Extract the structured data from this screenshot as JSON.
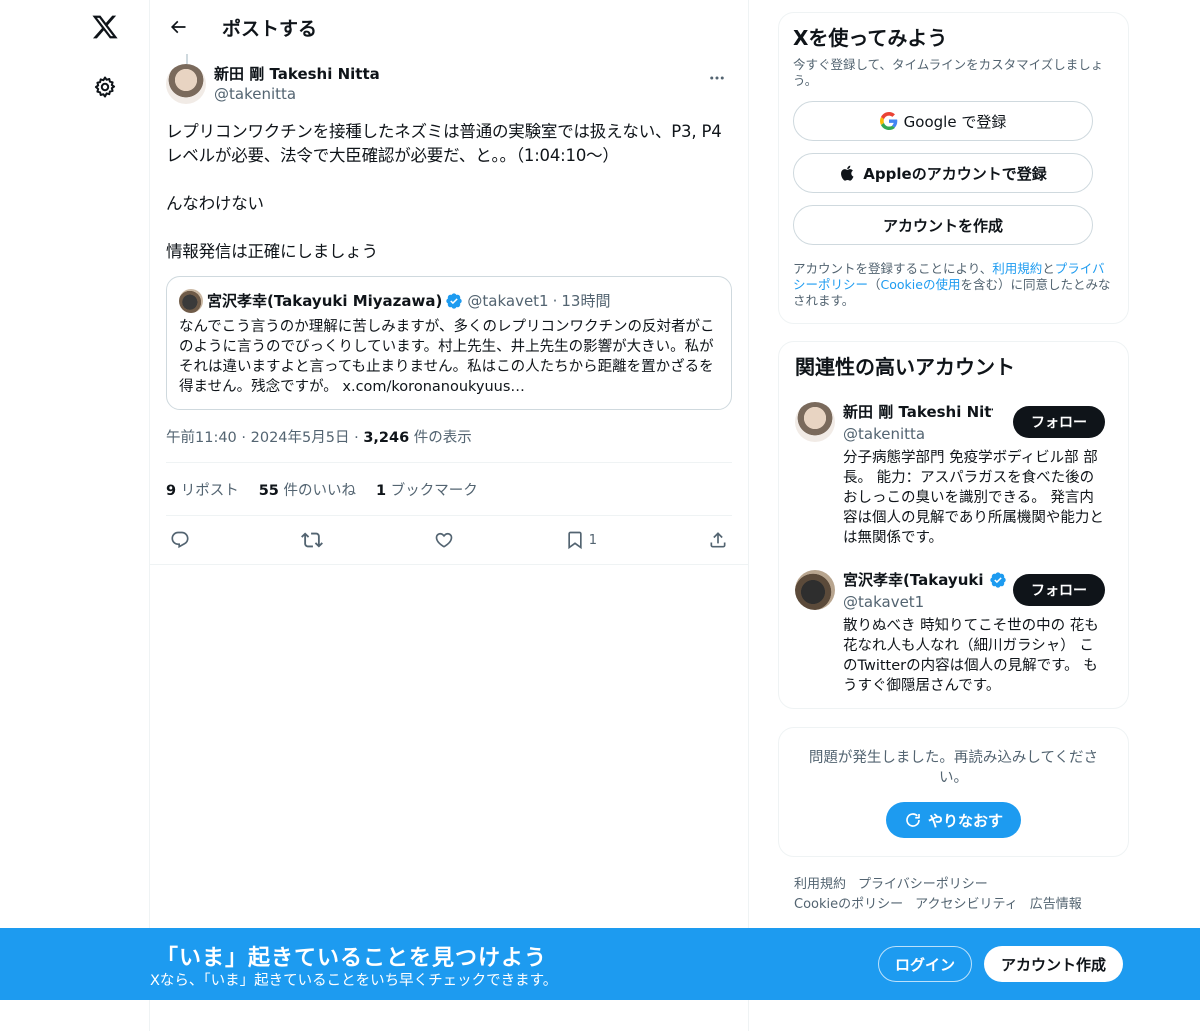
{
  "colors": {
    "accent": "#1d9bf0",
    "text": "#0f1419",
    "secondary": "#536471",
    "border": "#eff3f4"
  },
  "header": {
    "title": "ポストする"
  },
  "tweet": {
    "display_name": "新田 剛 Takeshi Nitta",
    "handle": "@takenitta",
    "body": "レプリコンワクチンを接種したネズミは普通の実験室では扱えない、P3, P4レベルが必要、法令で大臣確認が必要だ、と。。（1:04:10〜）\n\nんなわけない\n\n情報発信は正確にしましょう",
    "quote": {
      "display_name": "宮沢孝幸(Takayuki Miyazawa)",
      "handle": "@takavet1",
      "separator": "·",
      "time": "13時間",
      "body": "なんでこう言うのか理解に苦しみますが、多くのレプリコンワクチンの反対者がこのように言うのでびっくりしています。村上先生、井上先生の影響が大きい。私がそれは違いますよと言っても止まりません。私はこの人たちから距離を置かざるを得ません。残念ですが。 x.com/koronanoukyuus…"
    },
    "time": "午前11:40",
    "date": "2024年5月5日",
    "sep": "·",
    "views_count": "3,246",
    "views_label": "件の表示",
    "reposts_count": "9",
    "reposts_label": "リポスト",
    "likes_count": "55",
    "likes_label": "件のいいね",
    "bookmarks_count": "1",
    "bookmarks_label": "ブックマーク",
    "bookmark_action_count": "1"
  },
  "signup": {
    "title": "Xを使ってみよう",
    "subtitle": "今すぐ登録して、タイムラインをカスタマイズしましょう。",
    "google_label": "Google で登録",
    "apple_label": "Appleのアカウントで登録",
    "create_label": "アカウントを作成",
    "terms_pre": "アカウントを登録することにより、",
    "terms_link1": "利用規約",
    "terms_mid": "と",
    "terms_link2": "プライバシーポリシー",
    "terms_mid2": "（",
    "terms_link3": "Cookieの使用",
    "terms_post": "を含む）に同意したとみなされます。"
  },
  "related": {
    "title": "関連性の高いアカウント",
    "accounts": [
      {
        "name": "新田 剛 Takeshi Nitta",
        "handle": "@takenitta",
        "follow": "フォロー",
        "bio": "分子病態学部門 免疫学ボディビル部 部長。 能力：アスパラガスを食べた後のおしっこの臭いを識別できる。 発言内容は個人の見解であり所属機関や能力とは無関係です。"
      },
      {
        "name": "宮沢孝幸(Takayuki Miyazawa)",
        "handle": "@takavet1",
        "follow": "フォロー",
        "bio": "散りぬべき 時知りてこそ世の中の 花も花なれ人も人なれ（細川ガラシャ） このTwitterの内容は個人の見解です。 もうすぐ御隠居さんです。"
      }
    ]
  },
  "error": {
    "message": "問題が発生しました。再読み込みしてください。",
    "retry_label": "やりなおす"
  },
  "footer": {
    "links": [
      "利用規約",
      "プライバシーポリシー",
      "Cookieのポリシー",
      "アクセシビリティ",
      "広告情報"
    ]
  },
  "banner": {
    "title": "「いま」起きていることを見つけよう",
    "subtitle": "Xなら、「いま」起きていることをいち早くチェックできます。",
    "login_label": "ログイン",
    "create_label": "アカウント作成"
  }
}
